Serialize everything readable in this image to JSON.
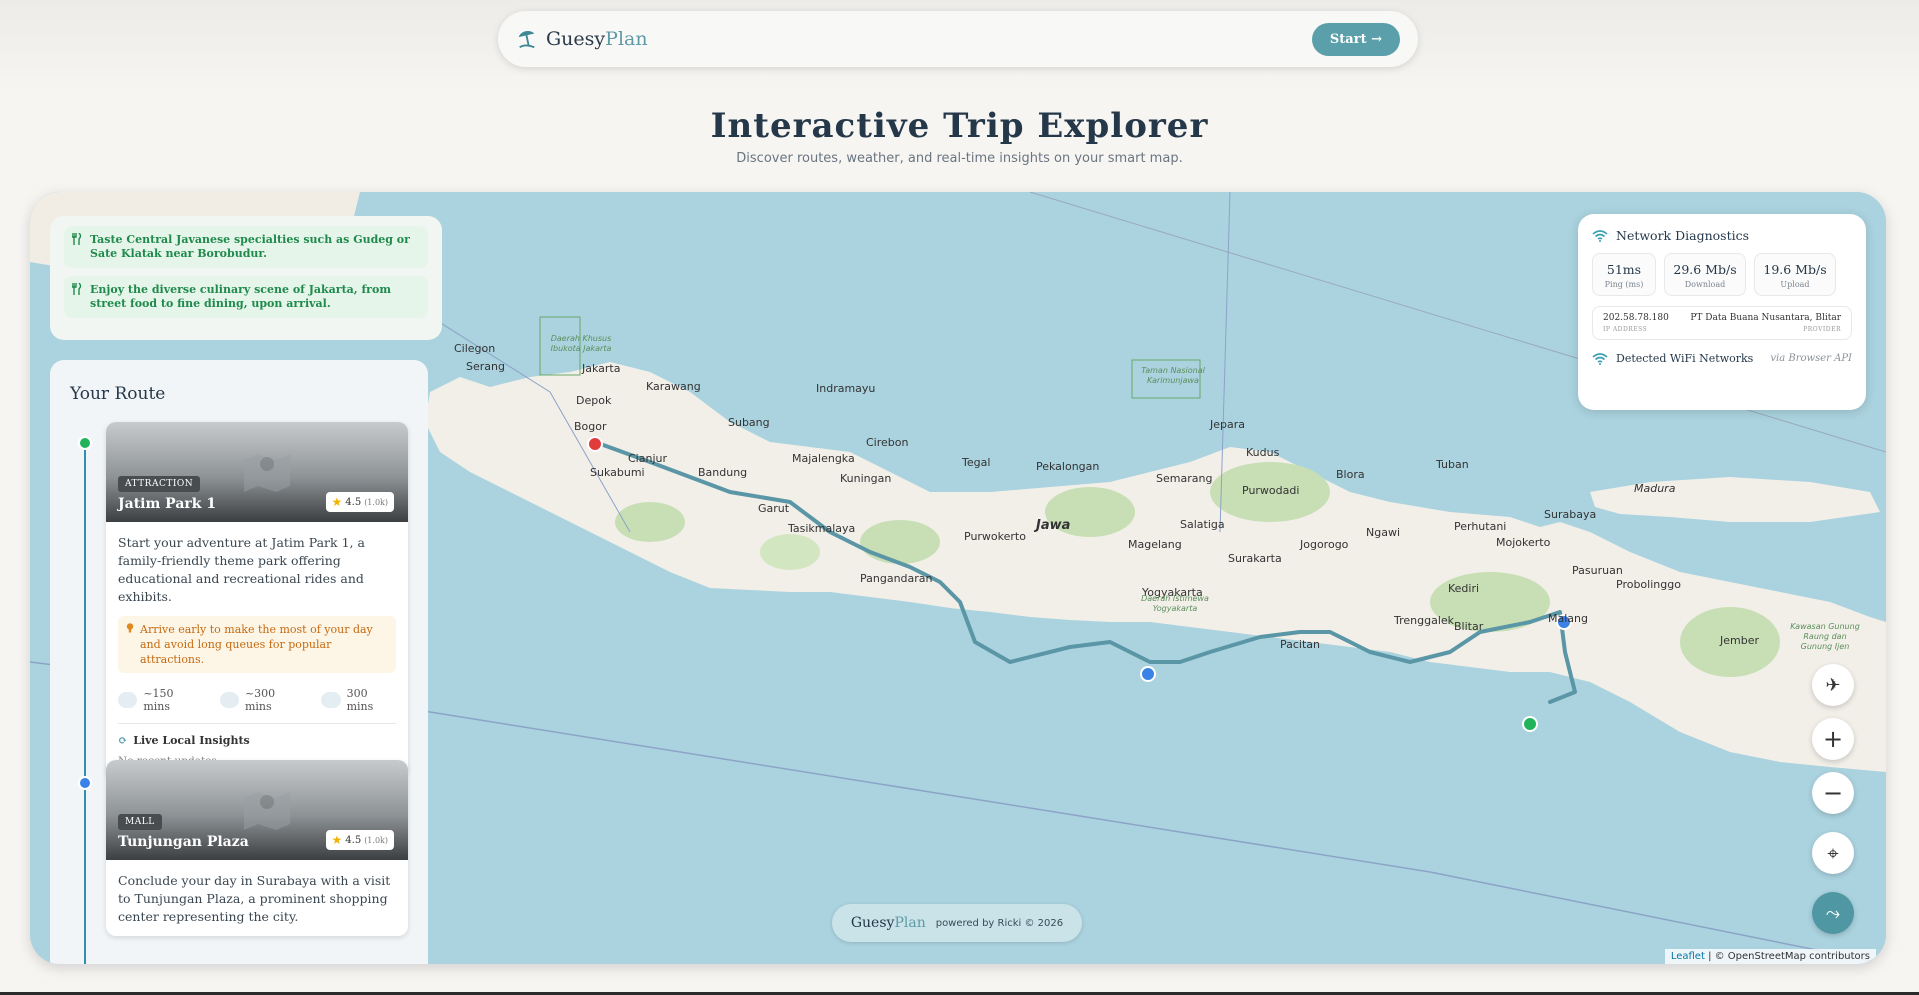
{
  "nav": {
    "brand_main": "Guesy",
    "brand_accent": "Plan",
    "start_label": "Start →"
  },
  "hero": {
    "title": "Interactive Trip Explorer",
    "subtitle": "Discover routes, weather, and real-time insights on your smart map."
  },
  "tips": [
    "Taste Central Javanese specialties such as Gudeg or Sate Klatak near Borobudur.",
    "Enjoy the diverse culinary scene of Jakarta, from street food to fine dining, upon arrival."
  ],
  "route": {
    "title": "Your Route",
    "stops": [
      {
        "badge": "ATTRACTION",
        "name": "Jatim Park 1",
        "rating": "4.5",
        "rating_count": "(1.0k)",
        "description": "Start your adventure at Jatim Park 1, a family-friendly theme park offering educational and recreational rides and exhibits.",
        "note": "Arrive early to make the most of your day and avoid long queues for popular attractions.",
        "bike": "~150 mins",
        "car": "~300 mins",
        "walk": "300 mins",
        "insights_label": "Live Local Insights",
        "insights_status": "No recent updates."
      },
      {
        "badge": "MALL",
        "name": "Tunjungan Plaza",
        "rating": "4.5",
        "rating_count": "(1.0k)",
        "description": "Conclude your day in Surabaya with a visit to Tunjungan Plaza, a prominent shopping center representing the city."
      }
    ]
  },
  "network": {
    "title": "Network Diagnostics",
    "ping_value": "51ms",
    "ping_label": "Ping (ms)",
    "download_value": "29.6 Mb/s",
    "download_label": "Download",
    "upload_value": "19.6 Mb/s",
    "upload_label": "Upload",
    "ip_value": "202.58.78.180",
    "ip_label": "IP ADDRESS",
    "provider_value": "PT Data Buana Nusantara, Blitar",
    "provider_label": "PROVIDER",
    "wifi_label": "Detected WiFi Networks",
    "wifi_source": "via Browser API"
  },
  "map": {
    "cities": [
      "Serang",
      "Jakarta",
      "Karawang",
      "Depok",
      "Bogor",
      "Subang",
      "Indramayu",
      "Cirebon",
      "Cianjur",
      "Bandung",
      "Majalengka",
      "Kuningan",
      "Sukabumi",
      "Garut",
      "Tasikmalaya",
      "Pangandaran",
      "Tegal",
      "Pekalongan",
      "Semarang",
      "Jepara",
      "Kudus",
      "Purwokerto",
      "Jawa",
      "Magelang",
      "Salatiga",
      "Yogyakarta",
      "Surakarta",
      "Purwodadi",
      "Blora",
      "Jogorogo",
      "Ngawi",
      "Tuban",
      "Surabaya",
      "Madura",
      "Mojokerto",
      "Pasuruan",
      "Probolinggo",
      "Kediri",
      "Malang",
      "Blitar",
      "Trenggalek",
      "Pacitan",
      "Jember",
      "Cilegon",
      "Perhutani"
    ],
    "protected": [
      "Daerah Khusus Ibukota Jakarta",
      "Taman Nasional Karimunjawa",
      "Daerah Istimewa Yogyakarta",
      "Kawasan Gunung Raung dan Gunung Ijen"
    ]
  },
  "footer": {
    "brand_main": "Guesy",
    "brand_accent": "Plan",
    "powered": "powered by Ricki © 2026"
  },
  "attribution": {
    "leaflet": "Leaflet",
    "osm": "| © OpenStreetMap contributors"
  },
  "colors": {
    "accent": "#5a9fa9",
    "route": "#5a96a5",
    "start_marker": "#e23b3b",
    "stop_marker": "#3a82e8",
    "green_marker": "#21b35a"
  },
  "icons": [
    "umbrella-beach-icon",
    "fork-knife-icon",
    "map-icon",
    "star-icon",
    "lightbulb-icon",
    "bike-icon",
    "car-icon",
    "walk-icon",
    "refresh-icon",
    "wifi-icon",
    "satellite-icon",
    "plus-icon",
    "minus-icon",
    "locate-icon",
    "route-icon"
  ]
}
